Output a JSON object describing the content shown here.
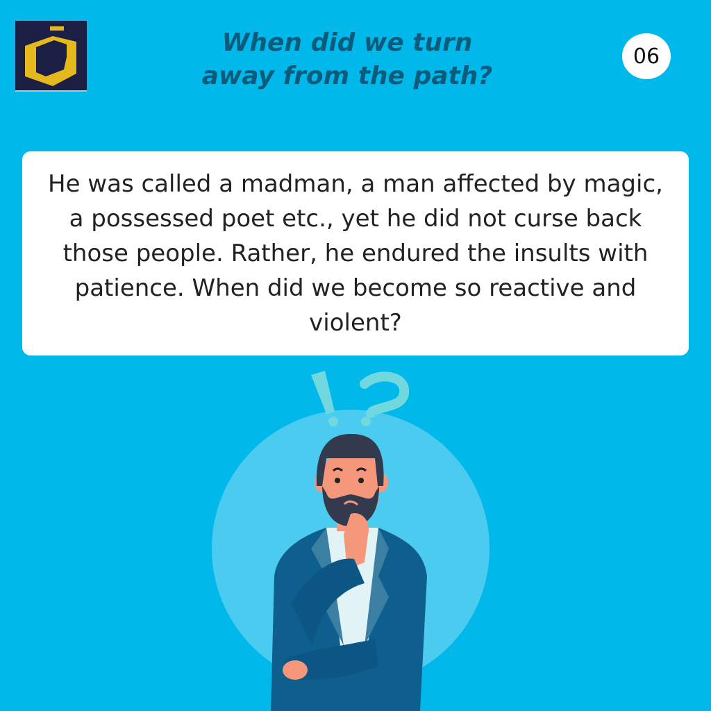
{
  "header": {
    "title_line1": "When did we turn",
    "title_line2": "away from the path?",
    "page_number": "06"
  },
  "card": {
    "text": "He was called a madman, a man affected by magic, a possessed poet etc., yet he did not curse back those people. Rather, he endured the insults with patience. When did we become so reactive and violent?"
  },
  "colors": {
    "background": "#00b9ea",
    "title": "#0b5b7c",
    "logo_bg": "#1b1f44",
    "logo_gold": "#e5b81e"
  },
  "illustration": {
    "subject": "thinking-man",
    "symbols": [
      "!",
      "?"
    ]
  }
}
